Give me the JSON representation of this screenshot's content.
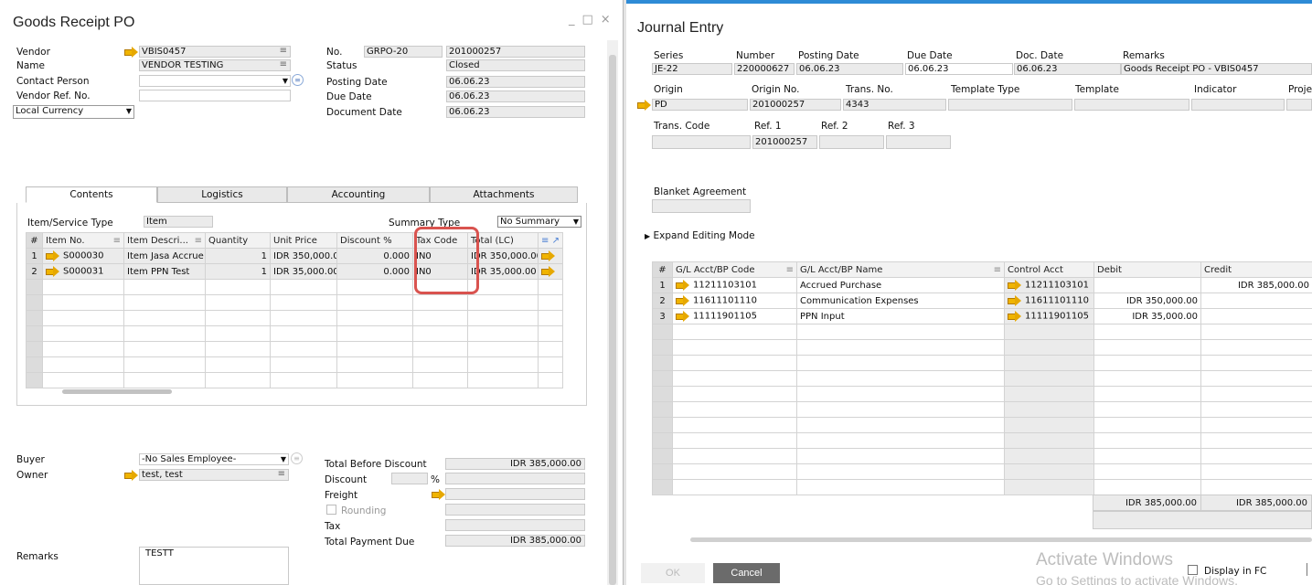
{
  "grpo": {
    "title": "Goods Receipt PO",
    "win_controls": [
      "_",
      "□",
      "×"
    ],
    "vendor_label": "Vendor",
    "vendor_value": "VBIS0457",
    "name_label": "Name",
    "name_value": "VENDOR TESTING",
    "contact_label": "Contact Person",
    "vendref_label": "Vendor Ref. No.",
    "currency_value": "Local Currency",
    "no_label": "No.",
    "no_series": "GRPO-20",
    "no_value": "201000257",
    "status_label": "Status",
    "status_value": "Closed",
    "posting_label": "Posting Date",
    "posting_value": "06.06.23",
    "due_label": "Due Date",
    "due_value": "06.06.23",
    "docdate_label": "Document Date",
    "docdate_value": "06.06.23",
    "tabs": [
      "Contents",
      "Logistics",
      "Accounting",
      "Attachments"
    ],
    "itemtype_label": "Item/Service Type",
    "itemtype_value": "Item",
    "summary_label": "Summary Type",
    "summary_value": "No Summary",
    "columns": [
      "#",
      "Item No.",
      "Item Descri...",
      "Quantity",
      "Unit Price",
      "Discount %",
      "Tax Code",
      "Total (LC)"
    ],
    "rows": [
      {
        "no": "1",
        "item": "S000030",
        "desc": "Item Jasa Accrue",
        "qty": "1",
        "price": "IDR 350,000.00",
        "disc": "0.000",
        "tax": "IN0",
        "total": "IDR 350,000.00"
      },
      {
        "no": "2",
        "item": "S000031",
        "desc": "Item PPN Test",
        "qty": "1",
        "price": "IDR 35,000.00",
        "disc": "0.000",
        "tax": "IN0",
        "total": "IDR 35,000.00"
      }
    ],
    "buyer_label": "Buyer",
    "buyer_value": "-No Sales Employee-",
    "owner_label": "Owner",
    "owner_value": "test, test",
    "remarks_label": "Remarks",
    "remarks_value": "TESTT",
    "tbd_label": "Total Before Discount",
    "tbd_value": "IDR 385,000.00",
    "discount_label": "Discount",
    "pct": "%",
    "freight_label": "Freight",
    "rounding_label": "Rounding",
    "tax_label": "Tax",
    "tpd_label": "Total Payment Due",
    "tpd_value": "IDR 385,000.00"
  },
  "je": {
    "title": "Journal Entry",
    "series_label": "Series",
    "series_value": "JE-22",
    "number_label": "Number",
    "number_value": "220000627",
    "posting_label": "Posting Date",
    "posting_value": "06.06.23",
    "due_label": "Due Date",
    "due_value": "06.06.23",
    "doc_label": "Doc. Date",
    "doc_value": "06.06.23",
    "remarks_label": "Remarks",
    "remarks_value": "Goods Receipt PO - VBIS0457",
    "origin_label": "Origin",
    "origin_value": "PD",
    "originno_label": "Origin No.",
    "originno_value": "201000257",
    "transno_label": "Trans. No.",
    "transno_value": "4343",
    "template_type_label": "Template Type",
    "template_label": "Template",
    "indicator_label": "Indicator",
    "project_label": "Proje",
    "transcode_label": "Trans. Code",
    "ref1_label": "Ref. 1",
    "ref1_value": "201000257",
    "ref2_label": "Ref. 2",
    "ref3_label": "Ref. 3",
    "blanket_label": "Blanket Agreement",
    "expand_label": "Expand Editing Mode",
    "columns": [
      "#",
      "G/L Acct/BP Code",
      "G/L Acct/BP Name",
      "Control Acct",
      "Debit",
      "Credit"
    ],
    "rows": [
      {
        "no": "1",
        "code": "11211103101",
        "name": "Accrued Purchase",
        "ctrl": "11211103101",
        "debit": "",
        "credit": "IDR 385,000.00"
      },
      {
        "no": "2",
        "code": "11611101110",
        "name": "Communication Expenses",
        "ctrl": "11611101110",
        "debit": "IDR 350,000.00",
        "credit": ""
      },
      {
        "no": "3",
        "code": "11111901105",
        "name": "PPN Input",
        "ctrl": "11111901105",
        "debit": "IDR 35,000.00",
        "credit": ""
      }
    ],
    "total_debit": "IDR 385,000.00",
    "total_credit": "IDR 385,000.00",
    "ok_label": "OK",
    "cancel_label": "Cancel",
    "display_fc_label": "Display in FC"
  },
  "watermark": {
    "line1": "Activate Windows",
    "line2": "Go to Settings to activate Windows."
  }
}
